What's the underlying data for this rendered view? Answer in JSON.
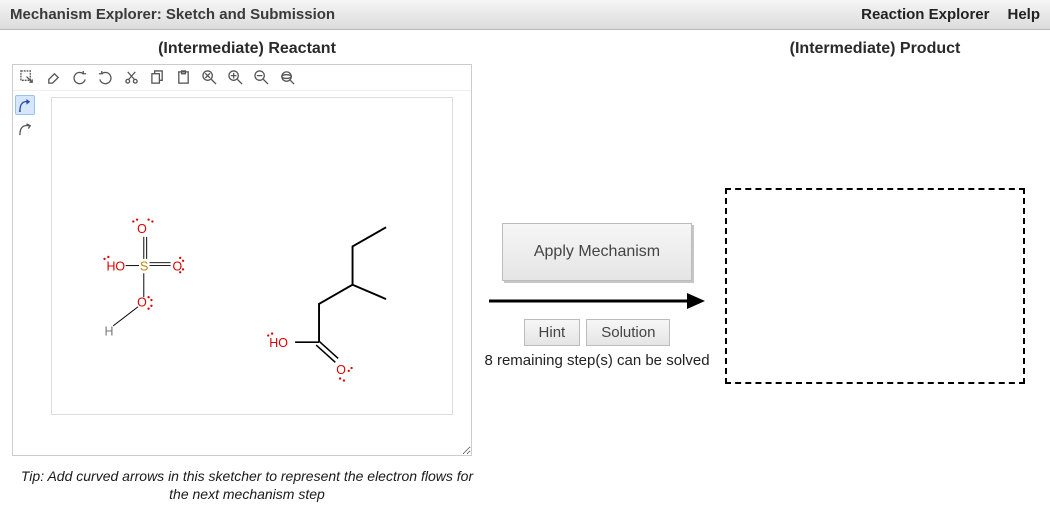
{
  "titlebar": {
    "title": "Mechanism Explorer: Sketch and Submission",
    "link_reaction": "Reaction Explorer",
    "link_help": "Help"
  },
  "reactant": {
    "heading": "(Intermediate) Reactant",
    "tip": "Tip: Add curved arrows in this sketcher to represent the electron flows for the next mechanism step"
  },
  "product": {
    "heading": "(Intermediate) Product"
  },
  "controls": {
    "apply": "Apply Mechanism",
    "hint": "Hint",
    "solution": "Solution",
    "remaining": "8 remaining step(s) can be solved"
  },
  "toolbar_top": [
    {
      "name": "select-tool-icon"
    },
    {
      "name": "erase-tool-icon"
    },
    {
      "name": "undo-icon"
    },
    {
      "name": "redo-icon"
    },
    {
      "name": "cut-icon"
    },
    {
      "name": "copy-icon"
    },
    {
      "name": "paste-icon"
    },
    {
      "name": "zoom-reset-icon"
    },
    {
      "name": "zoom-in-icon"
    },
    {
      "name": "zoom-out-icon"
    },
    {
      "name": "zoom-fit-icon"
    }
  ],
  "toolbar_left": [
    {
      "name": "curved-arrow-two-icon",
      "selected": true
    },
    {
      "name": "curved-arrow-one-icon",
      "selected": false
    }
  ]
}
